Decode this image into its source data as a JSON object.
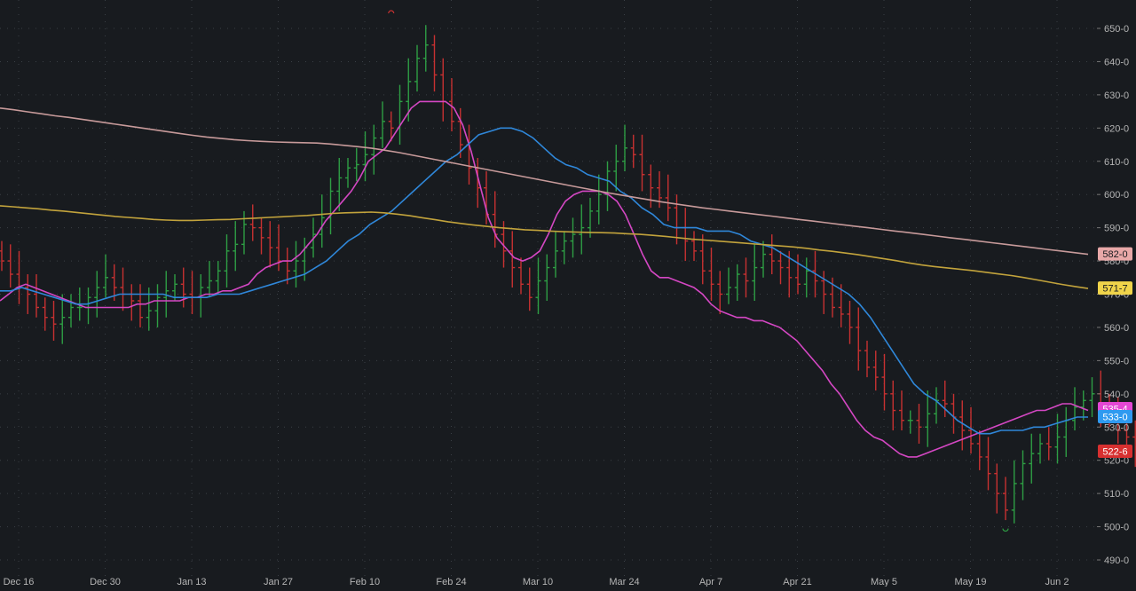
{
  "chart_data": {
    "type": "ohlc",
    "title": "",
    "xlabel": "",
    "ylabel": "",
    "ylim": [
      486,
      662
    ],
    "y_ticks": [
      "490-0",
      "500-0",
      "510-0",
      "520-0",
      "530-0",
      "540-0",
      "550-0",
      "560-0",
      "570-0",
      "580-0",
      "590-0",
      "600-0",
      "610-0",
      "620-0",
      "630-0",
      "640-0",
      "650-0"
    ],
    "x_tick_labels": [
      "Dec 16",
      "Dec 30",
      "Jan 13",
      "Jan 27",
      "Feb 10",
      "Feb 24",
      "Mar 10",
      "Mar 24",
      "Apr 7",
      "Apr 21",
      "May 5",
      "May 19",
      "Jun 2"
    ],
    "grid": true,
    "colors": {
      "background": "#181b1f",
      "up": "#2e9e44",
      "down": "#c73131",
      "grid": "#3a3f45",
      "axis_text": "#b5b5b5",
      "ma_pink": "#d447c3",
      "ma_blue": "#2f87d9",
      "ma_gold": "#c2a33c",
      "ma_rose": "#c79a9a"
    },
    "bars_per_label": 10,
    "closes": [
      580,
      576,
      572,
      570,
      566,
      563,
      561,
      563,
      566,
      566,
      569,
      572,
      575,
      572,
      570,
      568,
      563,
      565,
      569,
      571,
      573,
      570,
      569,
      572,
      574,
      577,
      583,
      585,
      591,
      590,
      587,
      584,
      580,
      577,
      580,
      584,
      588,
      593,
      601,
      605,
      608,
      609,
      612,
      617,
      622,
      620,
      628,
      634,
      641,
      645,
      636,
      628,
      622,
      615,
      608,
      602,
      594,
      588,
      583,
      578,
      573,
      569,
      574,
      578,
      583,
      586,
      588,
      590,
      595,
      600,
      607,
      610,
      614,
      612,
      606,
      602,
      599,
      596,
      590,
      586,
      583,
      577,
      573,
      570,
      572,
      576,
      574,
      578,
      582,
      580,
      578,
      575,
      573,
      577,
      574,
      570,
      566,
      564,
      560,
      553,
      548,
      545,
      540,
      535,
      532,
      532,
      530,
      534,
      538,
      537,
      533,
      529,
      525,
      521,
      516,
      510,
      505,
      513,
      519,
      522,
      525,
      524,
      527,
      532,
      536,
      538,
      540,
      536,
      533,
      529,
      527,
      524,
      522,
      526,
      528,
      531,
      533,
      536,
      535,
      538,
      537,
      534,
      531,
      527,
      523,
      522
    ],
    "series": [
      {
        "name": "",
        "color_key": "ma_pink",
        "values": [
          568,
          570,
          572,
          573,
          572,
          571,
          570,
          569,
          568,
          567,
          566,
          566,
          566,
          566,
          566,
          566,
          567,
          567,
          568,
          568,
          568,
          568,
          569,
          569,
          570,
          570,
          571,
          571,
          572,
          573,
          576,
          578,
          579,
          580,
          580,
          582,
          585,
          588,
          592,
          595,
          598,
          601,
          605,
          610,
          612,
          614,
          618,
          622,
          626,
          628,
          628,
          628,
          628,
          626,
          621,
          613,
          603,
          593,
          587,
          584,
          581,
          580,
          581,
          583,
          588,
          594,
          598,
          600,
          601,
          601,
          601,
          600,
          598,
          594,
          588,
          582,
          577,
          575,
          575,
          574,
          573,
          572,
          570,
          567,
          565,
          564,
          563,
          563,
          562,
          562,
          561,
          560,
          558,
          556,
          553,
          550,
          547,
          543,
          540,
          536,
          532,
          529,
          527,
          526,
          524,
          522,
          521,
          521,
          522,
          523,
          524,
          525,
          526,
          527,
          528,
          529,
          530,
          531,
          532,
          533,
          534,
          535,
          535,
          536,
          537,
          537,
          536,
          535
        ]
      },
      {
        "name": "",
        "color_key": "ma_blue",
        "values": [
          571,
          571,
          572,
          571,
          570,
          569,
          568,
          567,
          567,
          568,
          569,
          570,
          570,
          570,
          570,
          570,
          569,
          569,
          569,
          569,
          570,
          570,
          570,
          571,
          572,
          573,
          574,
          575,
          576,
          578,
          580,
          583,
          586,
          588,
          591,
          593,
          595,
          598,
          601,
          604,
          607,
          610,
          612,
          615,
          618,
          619,
          620,
          620,
          619,
          617,
          614,
          611,
          609,
          608,
          606,
          605,
          604,
          601,
          599,
          596,
          594,
          591,
          590,
          590,
          590,
          589,
          589,
          589,
          588,
          586,
          585,
          584,
          582,
          580,
          578,
          576,
          574,
          572,
          570,
          567,
          563,
          558,
          553,
          548,
          543,
          540,
          538,
          535,
          532,
          530,
          528,
          528,
          529,
          529,
          529,
          530,
          530,
          531,
          532,
          533,
          533
        ]
      },
      {
        "name": "",
        "color_key": "ma_gold",
        "values": [
          596.6,
          596.3,
          596,
          595.7,
          595.3,
          595,
          594.6,
          594.2,
          593.8,
          593.4,
          593.1,
          592.8,
          592.5,
          592.3,
          592.2,
          592.2,
          592.3,
          592.4,
          592.5,
          592.7,
          592.9,
          593.1,
          593.3,
          593.5,
          593.7,
          594.0,
          594.3,
          594.5,
          594.6,
          594.7,
          594.5,
          594.1,
          593.6,
          593.0,
          592.4,
          591.8,
          591.3,
          590.8,
          590.4,
          590.0,
          589.7,
          589.4,
          589.2,
          589.0,
          588.8,
          588.7,
          588.6,
          588.5,
          588.4,
          588.2,
          588.0,
          587.7,
          587.4,
          587.0,
          586.6,
          586.3,
          586.0,
          585.7,
          585.4,
          585.1,
          584.8,
          584.5,
          584.2,
          583.8,
          583.3,
          582.9,
          582.4,
          581.9,
          581.3,
          580.7,
          580.1,
          579.4,
          578.8,
          578.3,
          577.9,
          577.5,
          577.1,
          576.6,
          576.1,
          575.6,
          575.0,
          574.3,
          573.6,
          572.9,
          572.3,
          571.7
        ]
      },
      {
        "name": "",
        "color_key": "ma_rose",
        "values": [
          626.0,
          625.5,
          624.9,
          624.3,
          623.7,
          623.2,
          622.6,
          622.0,
          621.4,
          620.8,
          620.2,
          619.6,
          619.0,
          618.4,
          617.8,
          617.3,
          616.9,
          616.5,
          616.2,
          616.0,
          615.8,
          615.7,
          615.6,
          615.5,
          615.2,
          614.8,
          614.4,
          613.9,
          613.3,
          612.6,
          611.8,
          611.0,
          610.2,
          609.4,
          608.6,
          607.8,
          607.0,
          606.2,
          605.4,
          604.6,
          603.8,
          603.0,
          602.2,
          601.4,
          600.6,
          599.9,
          599.2,
          598.5,
          597.8,
          597.2,
          596.6,
          596.0,
          595.5,
          595.0,
          594.5,
          594.0,
          593.5,
          593.0,
          592.5,
          592.0,
          591.5,
          591.0,
          590.5,
          590.0,
          589.5,
          589.0,
          588.5,
          588.0,
          587.5,
          587.0,
          586.5,
          586.0,
          585.5,
          585.0,
          584.5,
          584.0,
          583.5,
          583.0,
          582.5,
          582.0
        ]
      }
    ],
    "price_tags": [
      {
        "value_num": 582.0,
        "label": "582-0",
        "bg": "#e8a8a8",
        "fg": "#181b1f"
      },
      {
        "value_num": 571.7,
        "label": "571-7",
        "bg": "#f0d44a",
        "fg": "#181b1f"
      },
      {
        "value_num": 535.4,
        "label": "535-4",
        "bg": "#e447d4",
        "fg": "#ffffff"
      },
      {
        "value_num": 533.0,
        "label": "533-0",
        "bg": "#2f9af0",
        "fg": "#ffffff"
      },
      {
        "value_num": 522.6,
        "label": "522-6",
        "bg": "#d73030",
        "fg": "#ffffff"
      }
    ],
    "marker_high": {
      "value": 654,
      "bar_index": 45
    },
    "marker_low": {
      "value": 500,
      "bar_index": 116
    }
  }
}
